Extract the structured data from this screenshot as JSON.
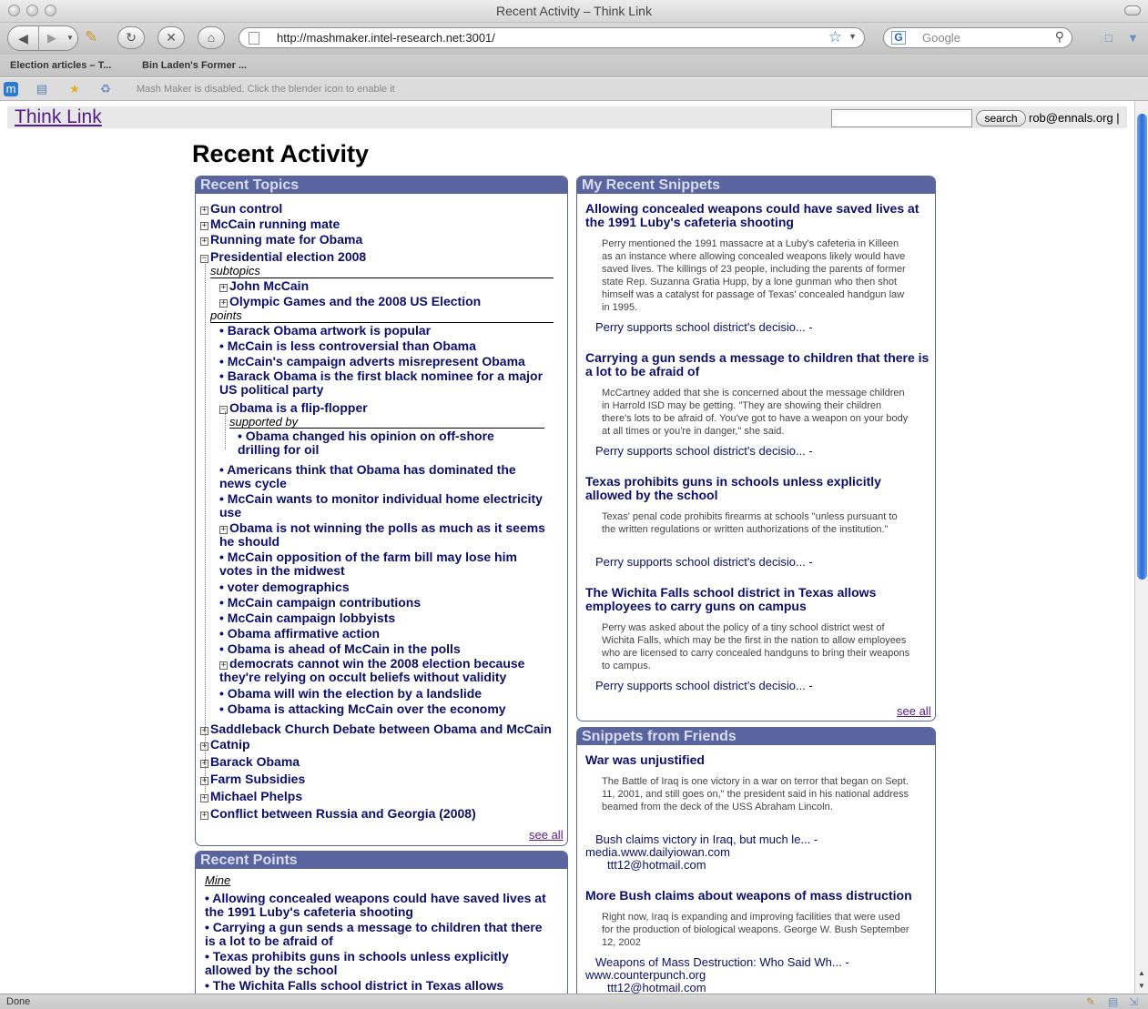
{
  "window": {
    "title": "Recent Activity – Think Link"
  },
  "toolbar": {
    "url": "http://mashmaker.intel-research.net:3001/",
    "search_placeholder": "Google"
  },
  "bookmarks": [
    "Election articles – T...",
    "Bin Laden's Former ..."
  ],
  "mashbar": {
    "message": "Mash Maker is disabled. Click the blender icon to enable it"
  },
  "site": {
    "logo": "Think Link",
    "search_button": "search",
    "user": "rob@ennals.org |"
  },
  "page": {
    "title": "Recent Activity"
  },
  "recent_topics": {
    "heading": "Recent Topics",
    "collapsed_top": [
      "Gun control",
      "McCain running mate",
      "Running mate for Obama"
    ],
    "expanded_topic": "Presidential election 2008",
    "subtopics_label": "subtopics",
    "subtopics": [
      "John McCain",
      "Olympic Games and the 2008 US Election"
    ],
    "points_label": "points",
    "points_a": [
      "Barack Obama artwork is popular",
      "McCain is less controversial than Obama",
      "McCain's campaign adverts misrepresent Obama",
      "Barack Obama is the first black nominee for a major US political party"
    ],
    "flip_flopper": "Obama is a flip-flopper",
    "supported_by_label": "supported by",
    "supported_point": "Obama changed his opinion on off-shore drilling for oil",
    "points_b": [
      "Americans think that Obama has dominated the news cycle",
      "McCain wants to monitor individual home electricity use",
      "Obama is not winning the polls as much as it seems he should",
      "McCain opposition of the farm bill may lose him votes in the midwest",
      "voter demographics",
      "McCain campaign contributions",
      "McCain campaign lobbyists",
      "Obama affirmative action",
      "Obama is ahead of McCain in the polls",
      "democrats cannot win the 2008 election because they're relying on occult beliefs without validity",
      "Obama will win the election by a landslide",
      "Obama is attacking McCain over the economy"
    ],
    "collapsed_bottom": [
      "Saddleback Church Debate between Obama and McCain",
      "Catnip",
      "Barack Obama",
      "Farm Subsidies",
      "Michael Phelps",
      "Conflict between Russia and Georgia (2008)"
    ],
    "see_all": "see all"
  },
  "recent_points": {
    "heading": "Recent Points",
    "mine_label": "Mine",
    "items": [
      "Allowing concealed weapons could have saved lives at the 1991 Luby's cafeteria shooting",
      "Carrying a gun sends a message to children that there is a lot to be afraid of",
      "Texas prohibits guns in schools unless explicitly allowed by the school",
      "The Wichita Falls school district in Texas allows"
    ]
  },
  "my_snippets": {
    "heading": "My Recent Snippets",
    "items": [
      {
        "title": "Allowing concealed weapons could have saved lives at the 1991 Luby's cafeteria shooting",
        "body": "Perry mentioned the 1991 massacre at a Luby's cafeteria in Killeen as an instance where allowing concealed weapons likely would have saved lives. The killings of 23 people, including the parents of former state Rep. Suzanna Gratia Hupp, by a lone gunman who then shot himself was a catalyst for passage of Texas' concealed handgun law in 1995.",
        "source": "Perry supports school district's decisio... -"
      },
      {
        "title": "Carrying a gun sends a message to children that there is a lot to be afraid of",
        "body": "McCartney added that she is concerned about the message children in Harrold ISD may be getting. \"They are showing their children there's lots to be afraid of. You've got to have a weapon on your body at all times or you're in danger,\" she said.",
        "source": "Perry supports school district's decisio... -"
      },
      {
        "title": "Texas prohibits guns in schools unless explicitly allowed by the school",
        "body": "Texas' penal code prohibits firearms at schools \"unless pursuant to the written regulations or written authorizations of the institution.\"",
        "source": "Perry supports school district's decisio... -"
      },
      {
        "title": "The Wichita Falls school district in Texas allows employees to carry guns on campus",
        "body": "Perry was asked about the policy of a tiny school district west of Wichita Falls, which may be the first in the nation to allow employees who are licensed to carry concealed handguns to bring their weapons to campus.",
        "source": "Perry supports school district's decisio... -"
      }
    ],
    "see_all": "see all"
  },
  "friends_snippets": {
    "heading": "Snippets from Friends",
    "items": [
      {
        "title": "War was unjustified",
        "body": "The Battle of Iraq is one victory in a war on terror that began on Sept. 11, 2001, and still goes on,\" the president said in his national address beamed from the deck of the USS Abraham Lincoln.",
        "source": "Bush claims victory in Iraq, but much le... -",
        "site": "media.www.dailyiowan.com",
        "user": "ttt12@hotmail.com"
      },
      {
        "title": "More Bush claims about weapons of mass distruction",
        "body": "Right now, Iraq is expanding and improving facilities that were used for the production of biological weapons. George W. Bush September 12, 2002",
        "source": "Weapons of Mass Destruction: Who Said Wh... -",
        "site": "www.counterpunch.org",
        "user": "ttt12@hotmail.com"
      }
    ]
  },
  "status": {
    "text": "Done"
  },
  "colors": {
    "panel_header": "#5a659f",
    "link_dark_blue": "#0c0f6a",
    "visited_link": "#551a8b"
  }
}
